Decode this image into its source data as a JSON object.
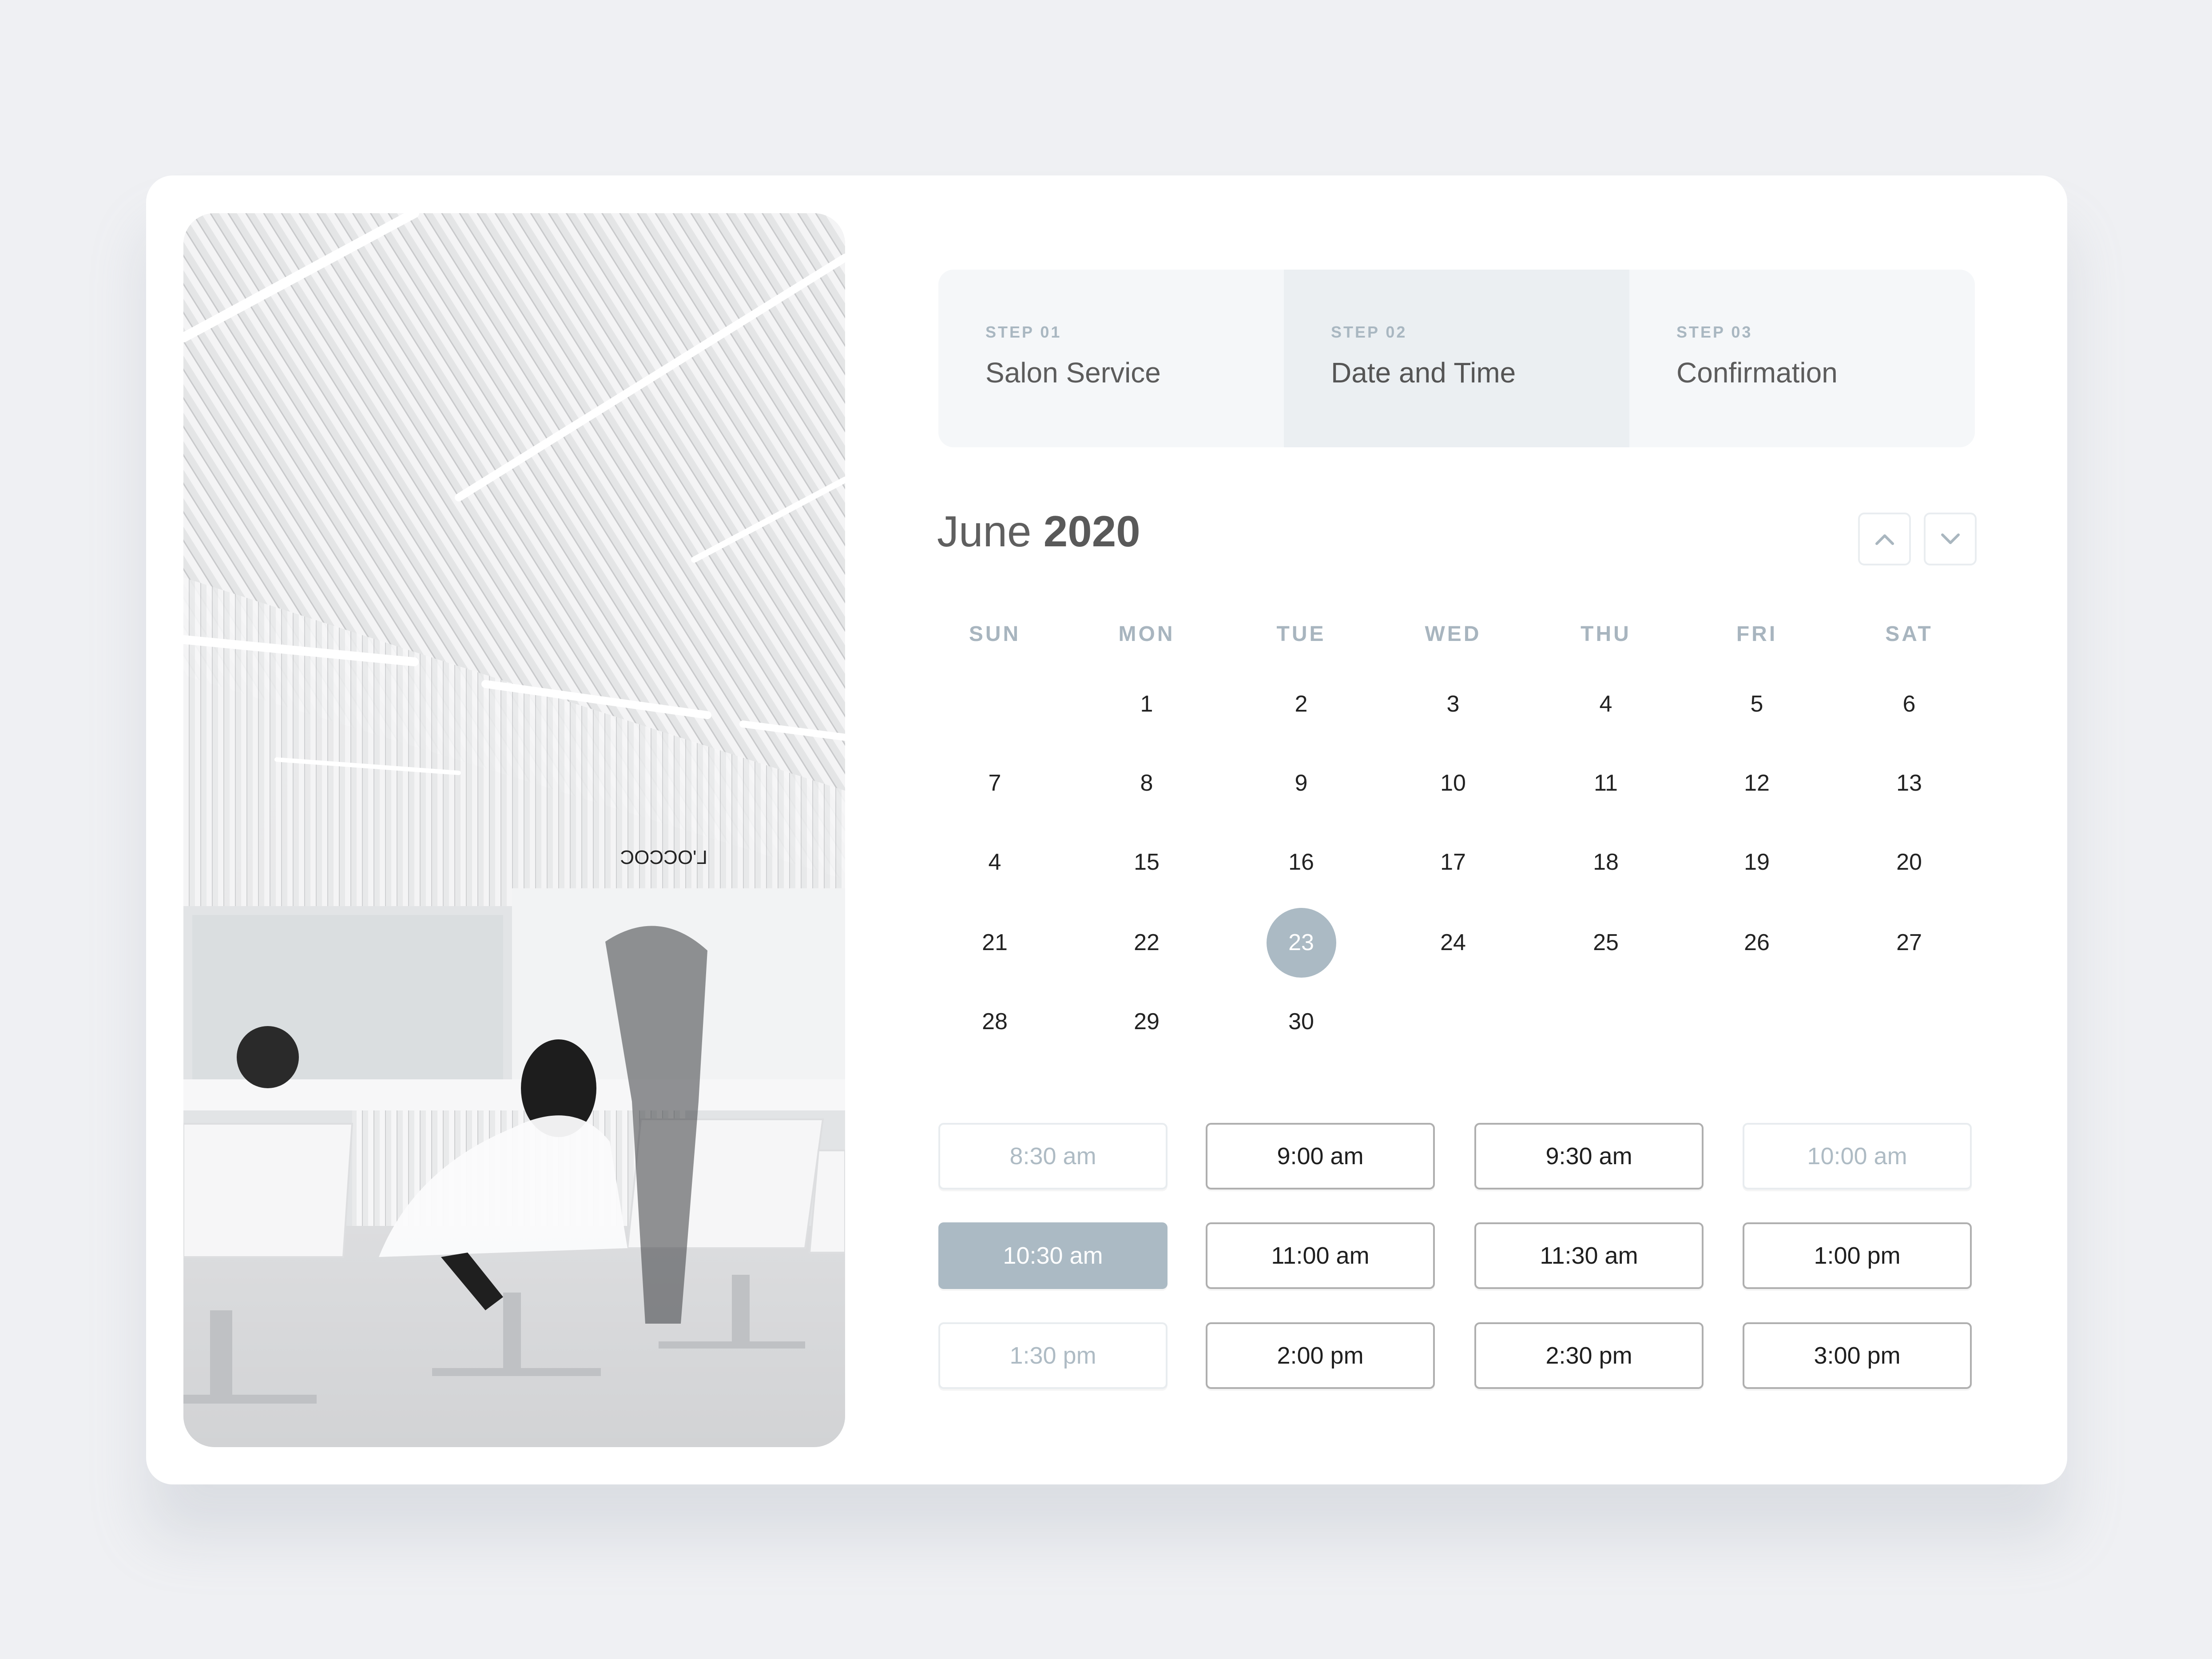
{
  "steps": [
    {
      "num": "STEP 01",
      "title": "Salon Service",
      "active": false
    },
    {
      "num": "STEP 02",
      "title": "Date and Time",
      "active": true
    },
    {
      "num": "STEP 03",
      "title": "Confirmation",
      "active": false
    }
  ],
  "calendar": {
    "month": "June",
    "year": "2020",
    "prev_icon": "chevron-up-icon",
    "next_icon": "chevron-down-icon",
    "weekdays": [
      "SUN",
      "MON",
      "TUE",
      "WED",
      "THU",
      "FRI",
      "SAT"
    ],
    "weeks": [
      [
        "",
        "1",
        "2",
        "3",
        "4",
        "5",
        "6"
      ],
      [
        "7",
        "8",
        "9",
        "10",
        "11",
        "12",
        "13"
      ],
      [
        "4",
        "15",
        "16",
        "17",
        "18",
        "19",
        "20"
      ],
      [
        "21",
        "22",
        "23",
        "24",
        "25",
        "26",
        "27"
      ],
      [
        "28",
        "29",
        "30",
        "",
        "",
        "",
        ""
      ]
    ],
    "selected_day": "23"
  },
  "time_slots": [
    {
      "label": "8:30 am",
      "state": "disabled"
    },
    {
      "label": "9:00 am",
      "state": "available"
    },
    {
      "label": "9:30 am",
      "state": "available"
    },
    {
      "label": "10:00 am",
      "state": "disabled"
    },
    {
      "label": "10:30 am",
      "state": "selected"
    },
    {
      "label": "11:00 am",
      "state": "available"
    },
    {
      "label": "11:30 am",
      "state": "available"
    },
    {
      "label": "1:00 pm",
      "state": "available"
    },
    {
      "label": "1:30 pm",
      "state": "disabled"
    },
    {
      "label": "2:00 pm",
      "state": "available"
    },
    {
      "label": "2:30 pm",
      "state": "available"
    },
    {
      "label": "3:00 pm",
      "state": "available"
    }
  ],
  "photo": {
    "description": "Salon interior with white slatted ceiling, mirrors and white styling chairs",
    "sign_text": "L'OCCOC"
  },
  "colors": {
    "accent": "#ABBAC4",
    "muted_text": "#A8B5BF",
    "active_step_bg": "#EBEFF2",
    "steps_bg": "#F5F7F9",
    "page_bg": "#EFF0F3"
  }
}
